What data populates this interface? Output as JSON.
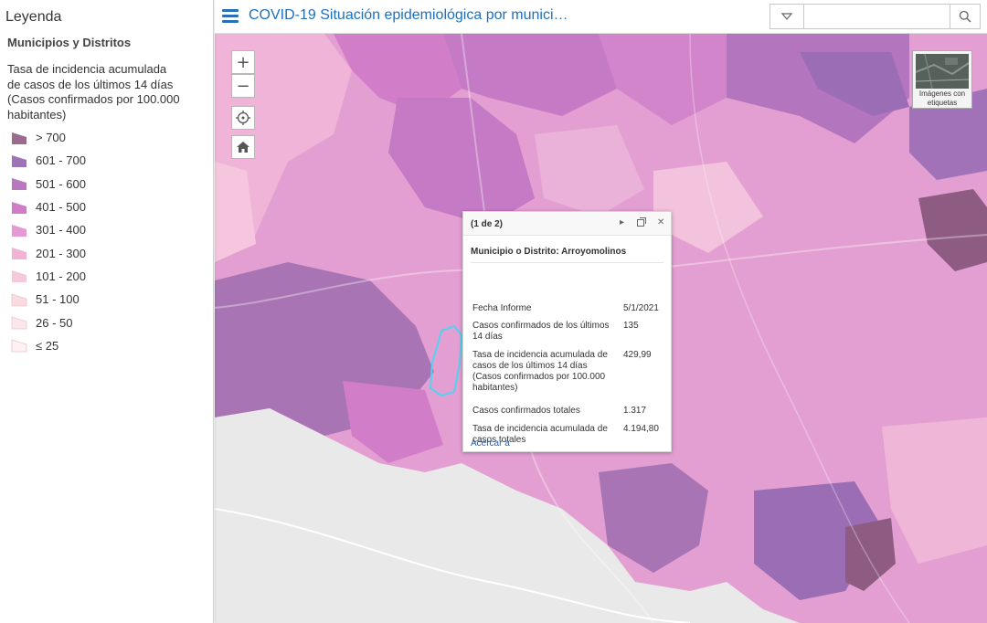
{
  "header": {
    "title": "COVID-19 Situación epidemiológica por munici…",
    "search_placeholder": ""
  },
  "legend": {
    "title": "Leyenda",
    "layer": "Municipios y Distritos",
    "field": "Tasa de incidencia acumulada de casos de los últimos 14 días (Casos confirmados por 100.000 habitantes)",
    "items": [
      {
        "label": "> 700",
        "color": "#9b6a8e"
      },
      {
        "label": "601 - 700",
        "color": "#9e72b6"
      },
      {
        "label": "501 - 600",
        "color": "#b877bf"
      },
      {
        "label": "401 - 500",
        "color": "#cf7ec6"
      },
      {
        "label": "301 - 400",
        "color": "#e59ad4"
      },
      {
        "label": "201 - 300",
        "color": "#f0b3d6"
      },
      {
        "label": "101 - 200",
        "color": "#f6c8db"
      },
      {
        "label": "51 - 100",
        "color": "#f9dbe0"
      },
      {
        "label": "26 - 50",
        "color": "#fbe6ea"
      },
      {
        "label": "≤ 25",
        "color": "#fdf1f3"
      }
    ]
  },
  "map": {
    "basemap_label": "Imágenes con etiquetas",
    "zoom_in": "+",
    "zoom_out": "−",
    "highlight_color": "#4fd3f0"
  },
  "popup": {
    "counter": "(1 de 2)",
    "title": "Municipio o Distrito: Arroyomolinos",
    "fields": [
      {
        "name": "Fecha Informe",
        "value": "5/1/2021"
      },
      {
        "name": "Casos confirmados de los últimos 14 días",
        "value": "135"
      },
      {
        "name": "Tasa de incidencia acumulada de casos de los últimos 14 días (Casos confirmados por 100.000 habitantes)",
        "value": "429,99"
      },
      {
        "name": "Casos confirmados totales",
        "value": "1.317"
      },
      {
        "name": "Tasa de incidencia acumulada de casos totales",
        "value": "4.194,80"
      }
    ],
    "zoom_link": "Acercar a"
  }
}
